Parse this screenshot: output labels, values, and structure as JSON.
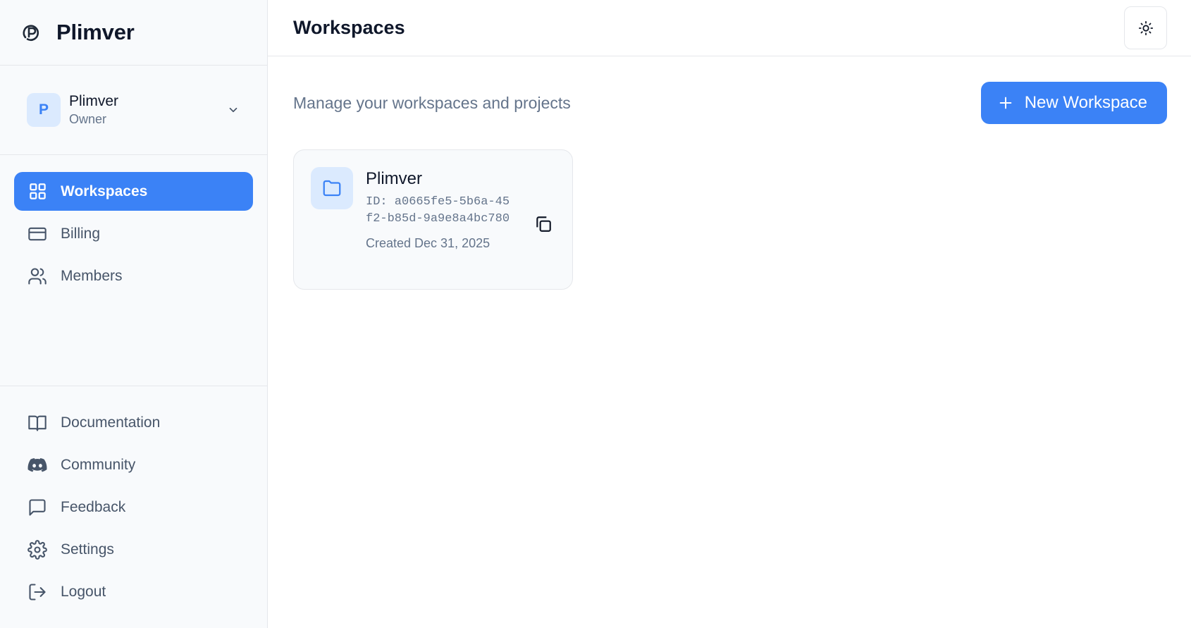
{
  "brand": {
    "name": "Plimver",
    "logo_icon": "plimver-logo-icon"
  },
  "account": {
    "initial": "P",
    "name": "Plimver",
    "role": "Owner"
  },
  "nav": {
    "primary": [
      {
        "label": "Workspaces",
        "icon": "grid-icon",
        "active": true
      },
      {
        "label": "Billing",
        "icon": "credit-card-icon",
        "active": false
      },
      {
        "label": "Members",
        "icon": "users-icon",
        "active": false
      }
    ],
    "secondary": [
      {
        "label": "Documentation",
        "icon": "book-icon"
      },
      {
        "label": "Community",
        "icon": "discord-icon"
      },
      {
        "label": "Feedback",
        "icon": "message-square-icon"
      },
      {
        "label": "Settings",
        "icon": "gear-icon"
      },
      {
        "label": "Logout",
        "icon": "logout-icon"
      }
    ]
  },
  "header": {
    "title": "Workspaces",
    "theme_toggle_icon": "sun-icon"
  },
  "main": {
    "subtitle": "Manage your workspaces and projects",
    "new_button_label": "New Workspace",
    "workspaces": [
      {
        "name": "Plimver",
        "id_text": "ID: a0665fe5-5b6a-45f2-b85d-9a9e8a4bc780",
        "created": "Created Dec 31, 2025"
      }
    ]
  },
  "colors": {
    "accent": "#3b82f6",
    "accent_light": "#dbeafe",
    "sidebar_bg": "#f8fafc",
    "muted_text": "#64748b"
  }
}
